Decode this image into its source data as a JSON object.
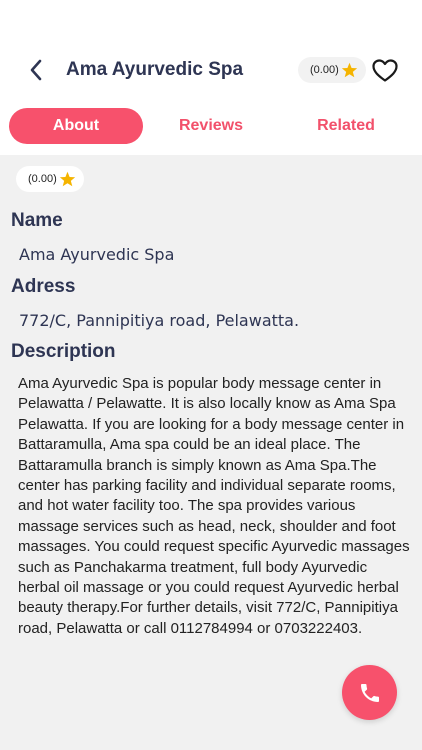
{
  "header": {
    "title": "Ama Ayurvedic Spa",
    "rating": "(0.00)",
    "back_icon": "chevron-left-icon",
    "favorite_icon": "heart-outline-icon"
  },
  "tabs": [
    {
      "label": "About",
      "active": true
    },
    {
      "label": "Reviews",
      "active": false
    },
    {
      "label": "Related",
      "active": false
    }
  ],
  "about": {
    "rating": "(0.00)",
    "name_label": "Name",
    "name_value": "Ama Ayurvedic Spa",
    "address_label": "Adress",
    "address_value": "772/C, Pannipitiya road, Pelawatta.",
    "description_label": "Description",
    "description_value": "Ama Ayurvedic Spa is popular body message center in Pelawatta / Pelawatte. It is also locally know as Ama Spa Pelawatta. If you are looking for a body message center in Battaramulla, Ama spa could be an ideal place. The Battaramulla branch is simply known as Ama Spa.The center has parking facility and individual separate rooms, and hot water facility too. The spa provides various massage services such as head, neck, shoulder and foot massages. You could request specific Ayurvedic massages such as Panchakarma treatment, full body Ayurvedic herbal oil massage or you could request Ayurvedic herbal beauty therapy.For further details, visit 772/C, Pannipitiya road, Pelawatta or call 0112784994 or 0703222403."
  },
  "fab": {
    "icon": "phone-icon"
  },
  "colors": {
    "accent": "#f7516c",
    "text": "#2e3553",
    "star": "#f5b400",
    "background": "#f1f1f1"
  }
}
